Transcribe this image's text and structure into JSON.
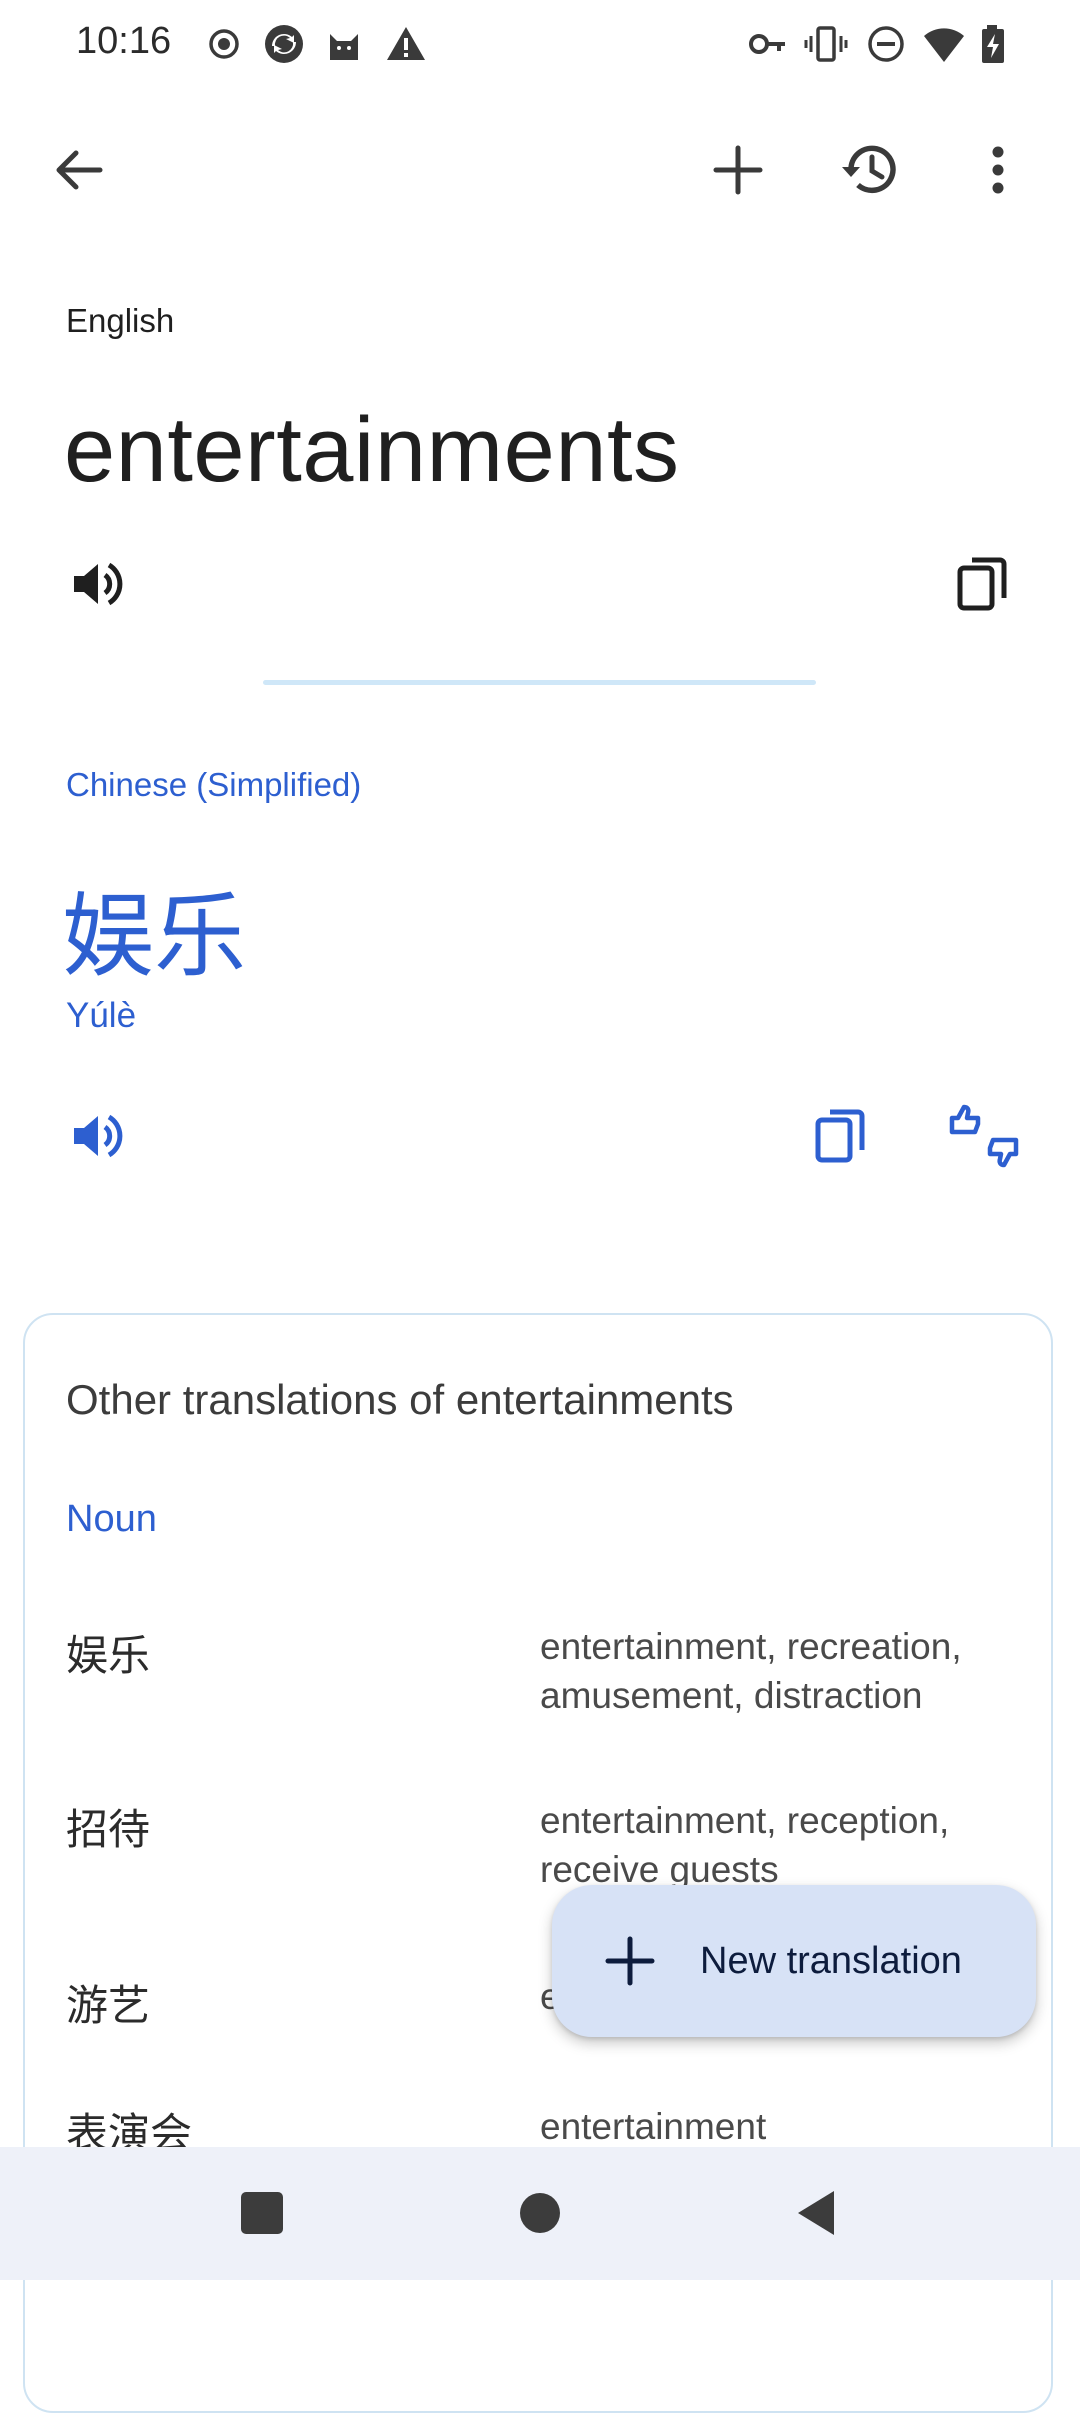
{
  "status_bar": {
    "time": "10:16",
    "left_icons": [
      "record-icon",
      "sync-icon",
      "cat-icon",
      "warning-icon"
    ],
    "right_icons": [
      "vpn-key-icon",
      "vibrate-icon",
      "dnd-icon",
      "wifi-icon",
      "battery-charging-icon"
    ]
  },
  "toolbar": {
    "icons": [
      "back-arrow-icon",
      "add-icon",
      "history-icon",
      "more-vert-icon"
    ]
  },
  "source": {
    "language": "English",
    "text": "entertainments"
  },
  "target": {
    "language": "Chinese (Simplified)",
    "text": "娱乐",
    "transliteration": "Yúlè"
  },
  "other_translations": {
    "title": "Other translations of entertainments",
    "part_of_speech": "Noun",
    "rows": [
      {
        "word": "娱乐",
        "synonyms": "entertainment, recreation, amusement, distraction"
      },
      {
        "word": "招待",
        "synonyms": "entertainment, reception, receive guests"
      },
      {
        "word": "游艺",
        "synonyms": "entertainment"
      },
      {
        "word": "表演会",
        "synonyms": "entertainment"
      }
    ]
  },
  "fab": {
    "label": "New translation"
  },
  "colors": {
    "accent": "#2d5fd0",
    "fab_bg": "#d7e2f6",
    "nav_bg": "#eef1f9"
  }
}
